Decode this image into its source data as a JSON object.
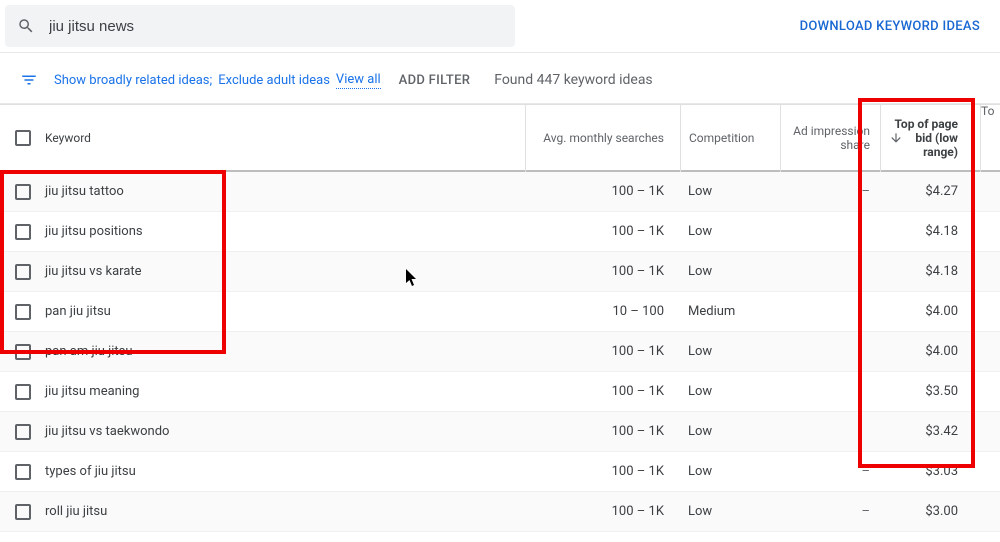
{
  "search": {
    "query": "jiu jitsu news"
  },
  "download_link": "DOWNLOAD KEYWORD IDEAS",
  "filters": {
    "broadly": "Show broadly related ideas;",
    "exclude": "Exclude adult ideas",
    "view_all": "View all",
    "add_filter": "ADD FILTER",
    "found": "Found 447 keyword ideas"
  },
  "headers": {
    "keyword": "Keyword",
    "searches": "Avg. monthly searches",
    "competition": "Competition",
    "impression": "Ad impression share",
    "bid": "Top of page bid (low range)",
    "last": "To"
  },
  "rows": [
    {
      "keyword": "jiu jitsu tattoo",
      "searches": "100 – 1K",
      "competition": "Low",
      "impression": "–",
      "bid": "$4.27"
    },
    {
      "keyword": "jiu jitsu positions",
      "searches": "100 – 1K",
      "competition": "Low",
      "impression": "",
      "bid": "$4.18"
    },
    {
      "keyword": "jiu jitsu vs karate",
      "searches": "100 – 1K",
      "competition": "Low",
      "impression": "",
      "bid": "$4.18"
    },
    {
      "keyword": "pan jiu jitsu",
      "searches": "10 – 100",
      "competition": "Medium",
      "impression": "",
      "bid": "$4.00"
    },
    {
      "keyword": "pan am jiu jitsu",
      "searches": "100 – 1K",
      "competition": "Low",
      "impression": "",
      "bid": "$4.00"
    },
    {
      "keyword": "jiu jitsu meaning",
      "searches": "100 – 1K",
      "competition": "Low",
      "impression": "",
      "bid": "$3.50"
    },
    {
      "keyword": "jiu jitsu vs taekwondo",
      "searches": "100 – 1K",
      "competition": "Low",
      "impression": "",
      "bid": "$3.42"
    },
    {
      "keyword": "types of jiu jitsu",
      "searches": "100 – 1K",
      "competition": "Low",
      "impression": "–",
      "bid": "$3.03"
    },
    {
      "keyword": "roll jiu jitsu",
      "searches": "100 – 1K",
      "competition": "Low",
      "impression": "–",
      "bid": "$3.00"
    }
  ]
}
